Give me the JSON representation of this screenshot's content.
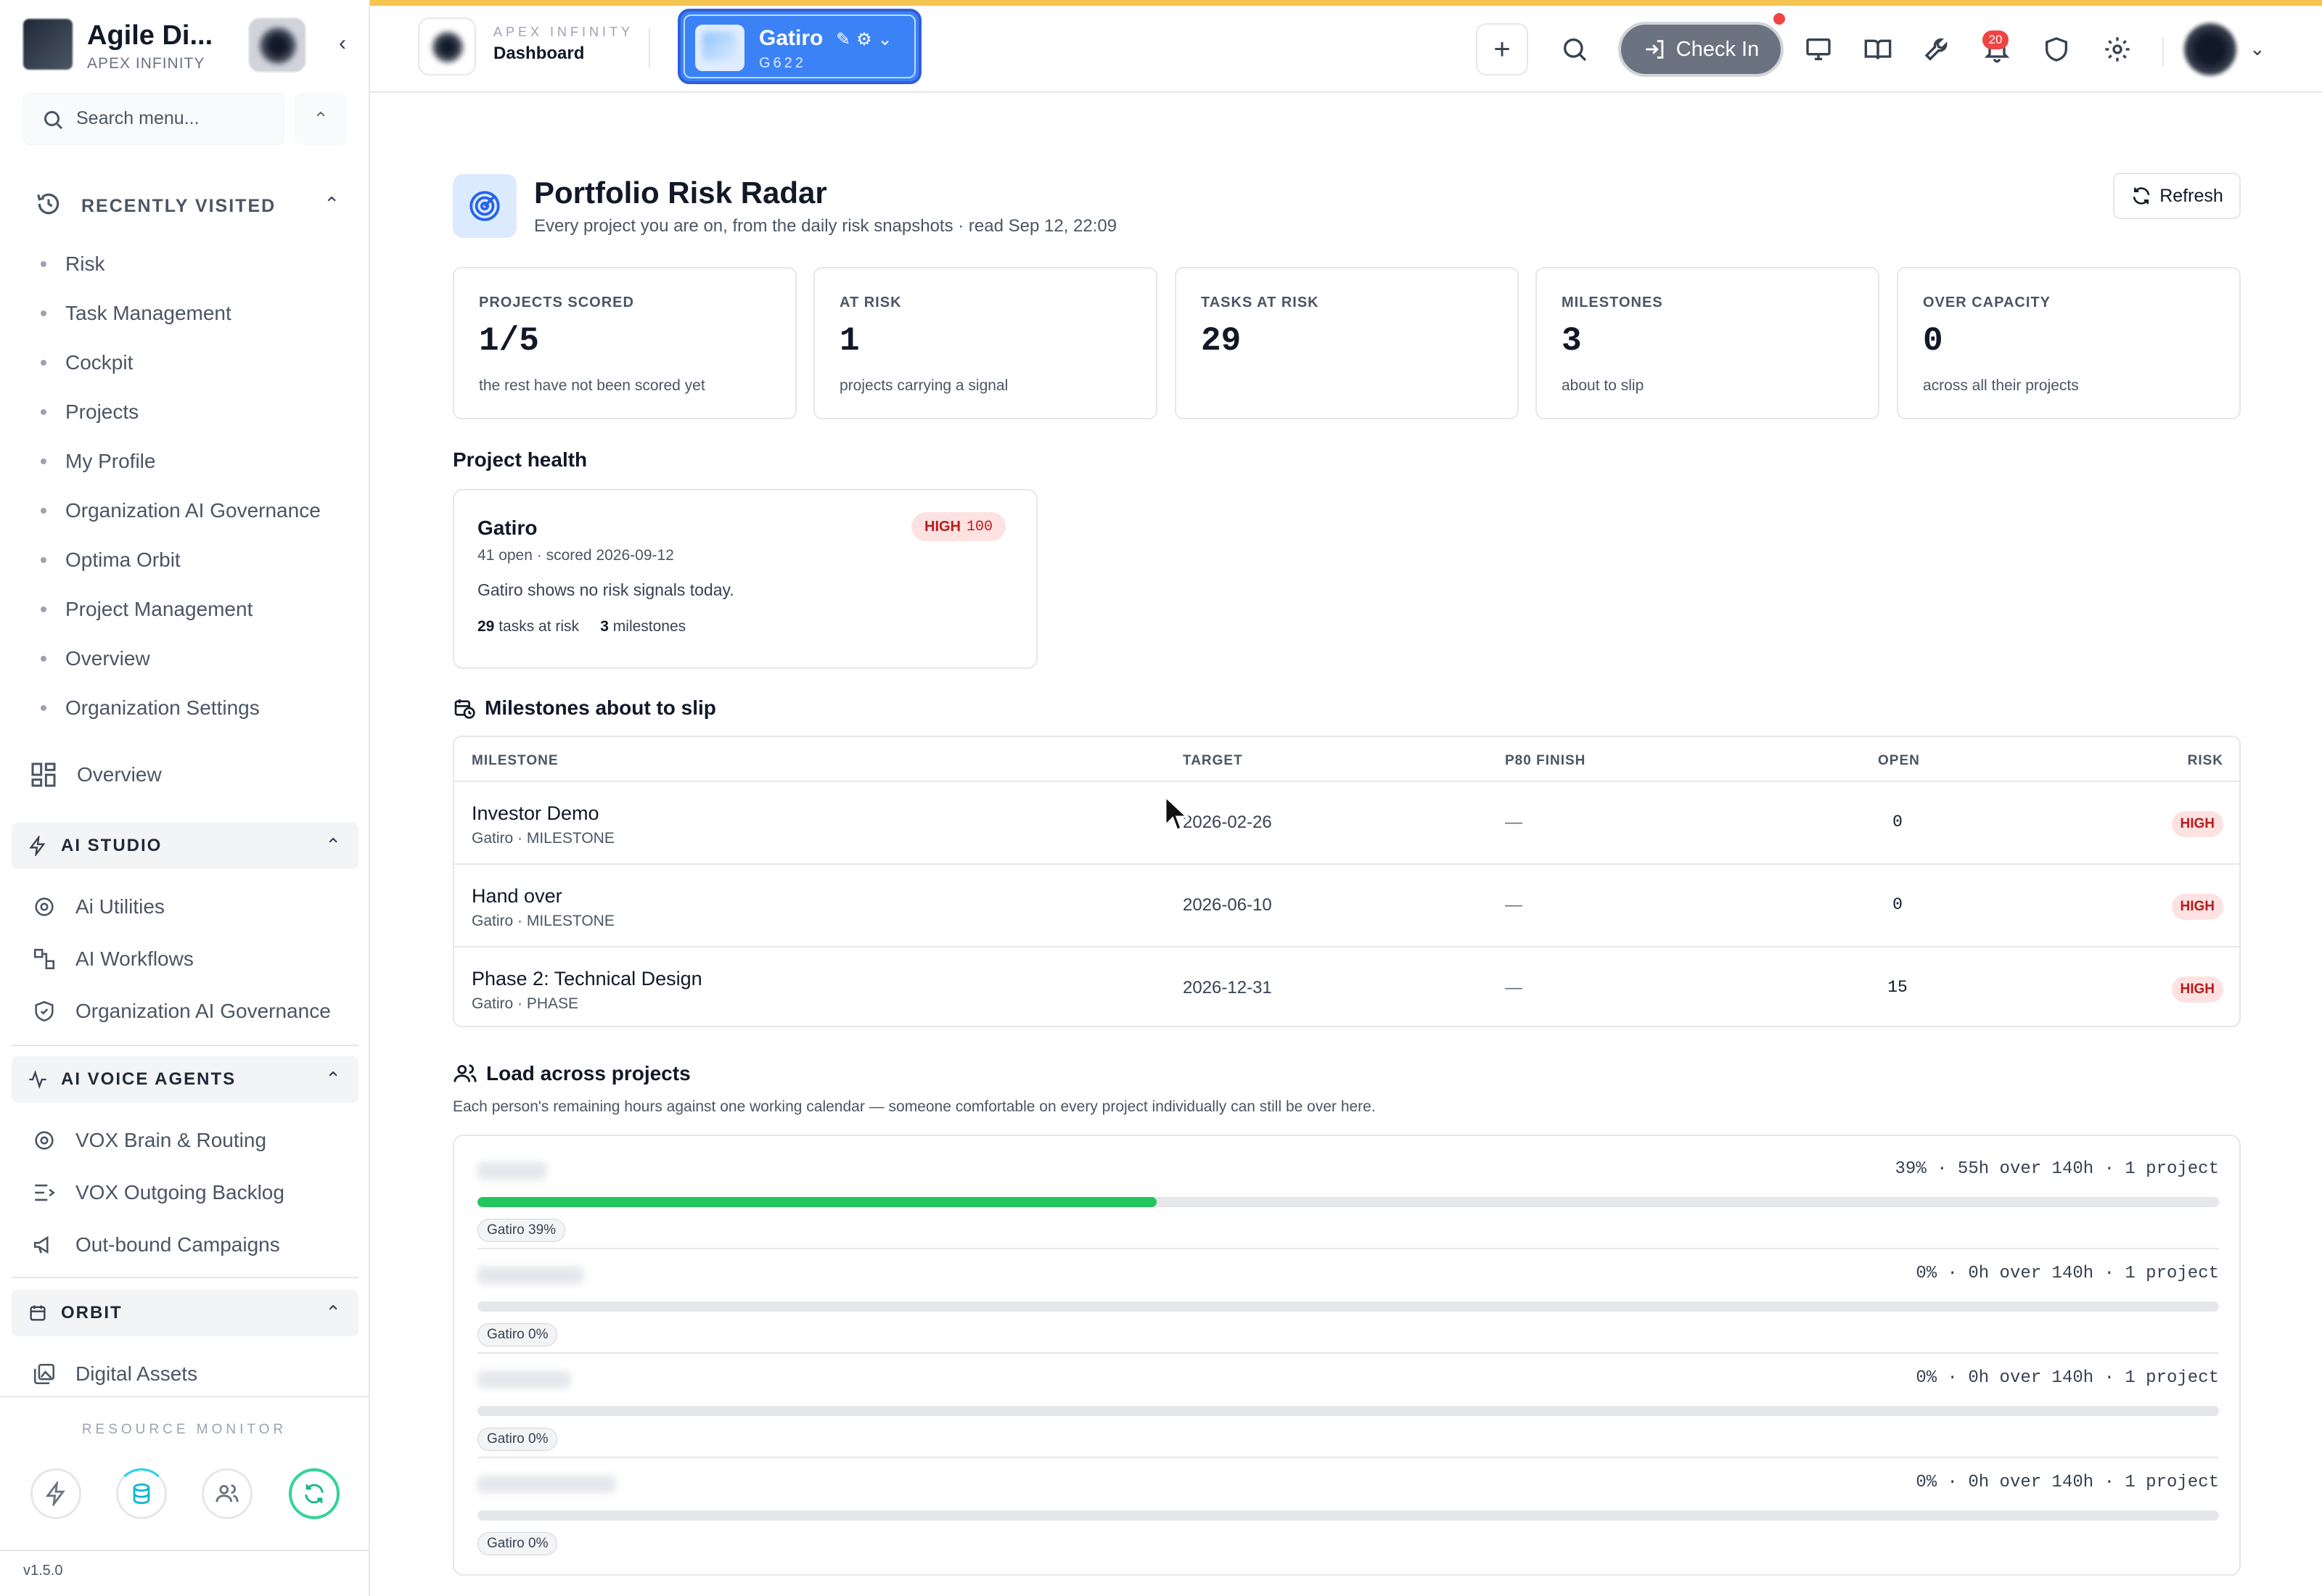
{
  "sidebar": {
    "app_name": "Agile Di...",
    "org_name": "APEX INFINITY",
    "search_placeholder": "Search menu...",
    "recently_visited": {
      "title": "RECENTLY VISITED",
      "items": [
        "Risk",
        "Task Management",
        "Cockpit",
        "Projects",
        "My Profile",
        "Organization AI Governance",
        "Optima Orbit",
        "Project Management",
        "Overview",
        "Organization Settings"
      ]
    },
    "overview_label": "Overview",
    "sections": [
      {
        "title": "AI STUDIO",
        "items": [
          "Ai Utilities",
          "AI Workflows",
          "Organization AI Governance"
        ]
      },
      {
        "title": "AI VOICE AGENTS",
        "items": [
          "VOX Brain & Routing",
          "VOX Outgoing Backlog",
          "Out-bound Campaigns"
        ]
      },
      {
        "title": "ORBIT",
        "items": [
          "Digital Assets"
        ]
      }
    ],
    "resource_monitor_title": "RESOURCE MONITOR",
    "version": "v1.5.0"
  },
  "topbar": {
    "brand": "APEX INFINITY",
    "page": "Dashboard",
    "project_name": "Gatiro",
    "project_code": "G622",
    "checkin_label": "Check In",
    "notification_count": "20"
  },
  "header": {
    "title": "Portfolio Risk Radar",
    "subtitle": "Every project you are on, from the daily risk snapshots · read Sep 12, 22:09",
    "refresh_label": "Refresh"
  },
  "stats": [
    {
      "label": "PROJECTS SCORED",
      "value": "1/5",
      "note": "the rest have not been scored yet"
    },
    {
      "label": "AT RISK",
      "value": "1",
      "note": "projects carrying a signal"
    },
    {
      "label": "TASKS AT RISK",
      "value": "29",
      "note": ""
    },
    {
      "label": "MILESTONES",
      "value": "3",
      "note": "about to slip"
    },
    {
      "label": "OVER CAPACITY",
      "value": "0",
      "note": "across all their projects"
    }
  ],
  "project_health": {
    "title": "Project health",
    "card": {
      "name": "Gatiro",
      "meta": "41 open · scored 2026-09-12",
      "level": "HIGH",
      "score": "100",
      "summary": "Gatiro shows no risk signals today.",
      "tasks_at_risk": "29",
      "tasks_label": "tasks at risk",
      "milestones": "3",
      "milestones_label": "milestones"
    }
  },
  "milestones": {
    "title": "Milestones about to slip",
    "columns": [
      "MILESTONE",
      "TARGET",
      "P80 FINISH",
      "OPEN",
      "RISK"
    ],
    "rows": [
      {
        "name": "Investor Demo",
        "sub": "Gatiro · MILESTONE",
        "target": "2026-02-26",
        "p80": "—",
        "open": "0",
        "risk": "HIGH"
      },
      {
        "name": "Hand over",
        "sub": "Gatiro · MILESTONE",
        "target": "2026-06-10",
        "p80": "—",
        "open": "0",
        "risk": "HIGH"
      },
      {
        "name": "Phase 2: Technical Design",
        "sub": "Gatiro · PHASE",
        "target": "2026-12-31",
        "p80": "—",
        "open": "15",
        "risk": "HIGH"
      }
    ]
  },
  "load": {
    "title": "Load across projects",
    "description": "Each person's remaining hours against one working calendar — someone comfortable on every project individually can still be over here.",
    "rows": [
      {
        "stat": "39% · 55h over 140h · 1 project",
        "fill_pct": 39,
        "chip": "Gatiro 39%"
      },
      {
        "stat": "0% · 0h over 140h · 1 project",
        "fill_pct": 0,
        "chip": "Gatiro 0%"
      },
      {
        "stat": "0% · 0h over 140h · 1 project",
        "fill_pct": 0,
        "chip": "Gatiro 0%"
      },
      {
        "stat": "0% · 0h over 140h · 1 project",
        "fill_pct": 0,
        "chip": "Gatiro 0%"
      }
    ]
  },
  "colors": {
    "accent": "#3b82f6",
    "risk_high": "#b91c1c",
    "load_fill": "#22c55e",
    "topbar_accent": "#f5c451"
  }
}
